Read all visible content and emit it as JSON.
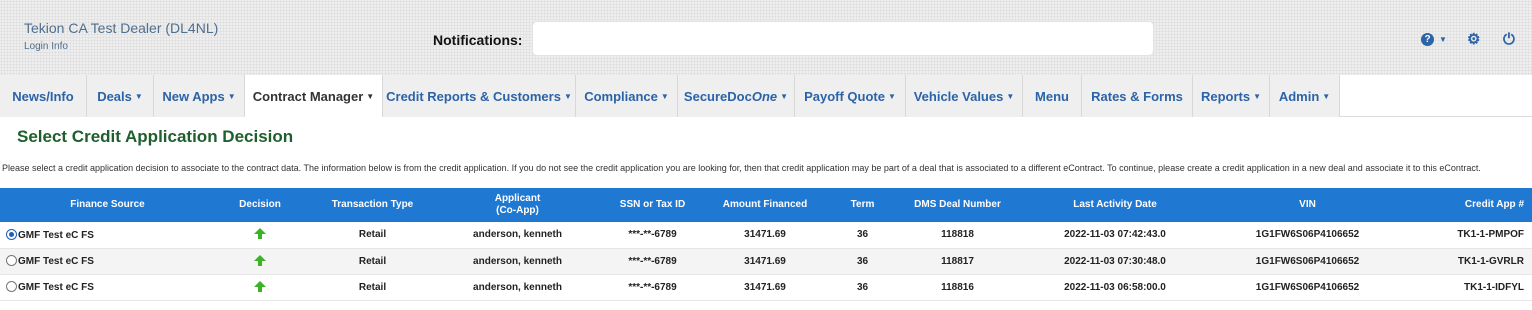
{
  "header": {
    "dealer_name": "Tekion CA Test Dealer (DL4NL)",
    "login_info": "Login Info",
    "notifications_label": "Notifications:",
    "notifications_value": ""
  },
  "nav": {
    "tabs": [
      {
        "label": "News/Info",
        "dropdown": false,
        "active": false
      },
      {
        "label": "Deals",
        "dropdown": true,
        "active": false
      },
      {
        "label": "New Apps",
        "dropdown": true,
        "active": false
      },
      {
        "label": "Contract Manager",
        "dropdown": true,
        "active": true
      },
      {
        "label": "Credit Reports & Customers",
        "dropdown": true,
        "active": false
      },
      {
        "label": "Compliance",
        "dropdown": true,
        "active": false
      },
      {
        "label": "SecureDoc",
        "label_em": "One",
        "dropdown": true,
        "active": false
      },
      {
        "label": "Payoff Quote",
        "dropdown": true,
        "active": false
      },
      {
        "label": "Vehicle Values",
        "dropdown": true,
        "active": false
      },
      {
        "label": "Menu",
        "dropdown": false,
        "active": false
      },
      {
        "label": "Rates & Forms",
        "dropdown": false,
        "active": false
      },
      {
        "label": "Reports",
        "dropdown": true,
        "active": false
      },
      {
        "label": "Admin",
        "dropdown": true,
        "active": false
      }
    ]
  },
  "page": {
    "title": "Select Credit Application Decision",
    "description": "Please select a credit application decision to associate to the contract data. The information below is from the credit application. If you do not see the credit application you are looking for, then that credit application may be part of a deal that is associated to a different eContract. To continue, please create a credit application in a new deal and associate it to this eContract."
  },
  "table": {
    "headers": {
      "finance_source": "Finance Source",
      "decision": "Decision",
      "transaction_type": "Transaction Type",
      "applicant": "Applicant",
      "co_app": "(Co-App)",
      "ssn": "SSN or Tax ID",
      "amount_financed": "Amount Financed",
      "term": "Term",
      "dms_deal_number": "DMS Deal Number",
      "last_activity_date": "Last Activity Date",
      "vin": "VIN",
      "credit_app": "Credit App #"
    },
    "rows": [
      {
        "selected": true,
        "finance_source": "GMF Test eC FS",
        "decision": "arrow-up-icon",
        "transaction_type": "Retail",
        "applicant": "anderson, kenneth",
        "ssn": "***-**-6789",
        "amount_financed": "31471.69",
        "term": "36",
        "dms_deal_number": "118818",
        "last_activity_date": "2022-11-03 07:42:43.0",
        "vin": "1G1FW6S06P4106652",
        "credit_app": "TK1-1-PMPOF"
      },
      {
        "selected": false,
        "finance_source": "GMF Test eC FS",
        "decision": "arrow-up-icon",
        "transaction_type": "Retail",
        "applicant": "anderson, kenneth",
        "ssn": "***-**-6789",
        "amount_financed": "31471.69",
        "term": "36",
        "dms_deal_number": "118817",
        "last_activity_date": "2022-11-03 07:30:48.0",
        "vin": "1G1FW6S06P4106652",
        "credit_app": "TK1-1-GVRLR"
      },
      {
        "selected": false,
        "finance_source": "GMF Test eC FS",
        "decision": "arrow-up-icon",
        "transaction_type": "Retail",
        "applicant": "anderson, kenneth",
        "ssn": "***-**-6789",
        "amount_financed": "31471.69",
        "term": "36",
        "dms_deal_number": "118816",
        "last_activity_date": "2022-11-03 06:58:00.0",
        "vin": "1G1FW6S06P4106652",
        "credit_app": "TK1-1-IDFYL"
      }
    ]
  },
  "colors": {
    "header_bg": "#eeeeee",
    "link_blue": "#2b63a8",
    "table_header_bg": "#1f78d1",
    "title_green": "#1f5f2e",
    "approved_arrow": "#3bb324"
  }
}
